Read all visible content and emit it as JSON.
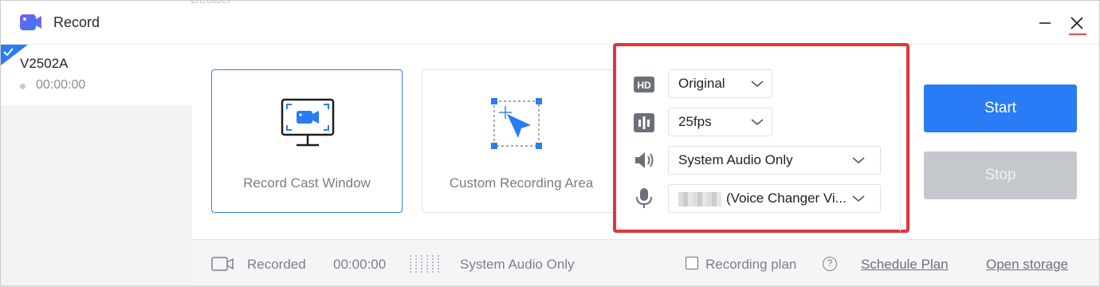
{
  "window": {
    "title": "Record",
    "background_ghost_text": "Decibel"
  },
  "sidebar": {
    "session": {
      "name": "V2502A",
      "time": "00:00:00"
    }
  },
  "sources": {
    "cast_window_label": "Record Cast Window",
    "custom_area_label": "Custom Recording Area"
  },
  "settings": {
    "quality": {
      "icon": "hd-icon",
      "value": "Original"
    },
    "framerate": {
      "icon": "fps-bars-icon",
      "value": "25fps"
    },
    "system_audio": {
      "icon": "speaker-icon",
      "value": "System Audio Only"
    },
    "microphone": {
      "icon": "microphone-icon",
      "value": "(Voice Changer Vi..."
    }
  },
  "actions": {
    "start_label": "Start",
    "stop_label": "Stop"
  },
  "footer": {
    "recorded_label": "Recorded",
    "recorded_time": "00:00:00",
    "audio_mode": "System Audio Only",
    "recording_plan_label": "Recording plan",
    "help_glyph": "?",
    "schedule_plan_link": "Schedule Plan",
    "open_storage_link": "Open storage"
  },
  "colors": {
    "accent": "#2a7cf6",
    "highlight_border": "#e5343b",
    "disabled": "#c4c7cc"
  }
}
